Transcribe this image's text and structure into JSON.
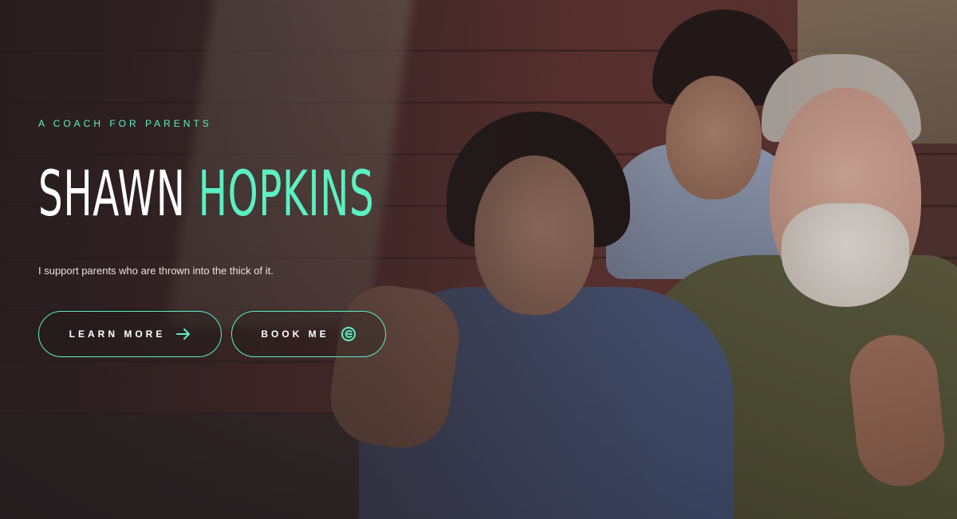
{
  "hero": {
    "eyebrow": "A COACH FOR PARENTS",
    "title_first": "SHAWN",
    "title_last": "HOPKINS",
    "subtitle": "I support parents who are thrown into the thick of it.",
    "buttons": {
      "learn_more": "LEARN MORE",
      "book_me": "BOOK ME"
    }
  },
  "colors": {
    "accent": "#5af0c2",
    "text": "#ffffff",
    "background": "#2b2224"
  },
  "icons": {
    "learn_more": "arrow-right-icon",
    "book_me": "booking-logo-icon"
  }
}
